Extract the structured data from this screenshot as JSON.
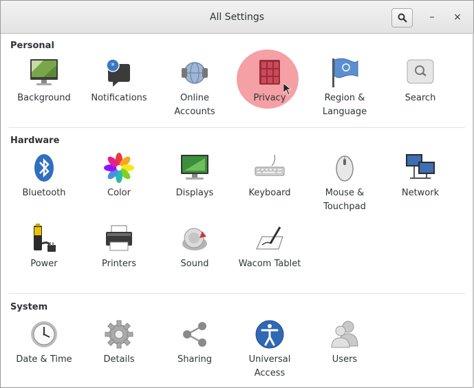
{
  "window": {
    "title": "All Settings",
    "minimize_glyph": "–",
    "close_glyph": "×"
  },
  "sections": {
    "personal": {
      "title": "Personal",
      "items": [
        {
          "label": "Background",
          "icon": "background-icon"
        },
        {
          "label": "Notifications",
          "icon": "notifications-icon"
        },
        {
          "label": "Online\nAccounts",
          "icon": "online-accounts-icon"
        },
        {
          "label": "Privacy",
          "icon": "privacy-icon"
        },
        {
          "label": "Region &\nLanguage",
          "icon": "region-flag-icon"
        },
        {
          "label": "Search",
          "icon": "search-icon"
        }
      ]
    },
    "hardware": {
      "title": "Hardware",
      "items": [
        {
          "label": "Bluetooth",
          "icon": "bluetooth-icon"
        },
        {
          "label": "Color",
          "icon": "color-icon"
        },
        {
          "label": "Displays",
          "icon": "displays-icon"
        },
        {
          "label": "Keyboard",
          "icon": "keyboard-icon"
        },
        {
          "label": "Mouse &\nTouchpad",
          "icon": "mouse-icon"
        },
        {
          "label": "Network",
          "icon": "network-icon"
        },
        {
          "label": "Power",
          "icon": "power-icon"
        },
        {
          "label": "Printers",
          "icon": "printer-icon"
        },
        {
          "label": "Sound",
          "icon": "sound-icon"
        },
        {
          "label": "Wacom Tablet",
          "icon": "wacom-tablet-icon"
        }
      ]
    },
    "system": {
      "title": "System",
      "items": [
        {
          "label": "Date & Time",
          "icon": "clock-icon"
        },
        {
          "label": "Details",
          "icon": "details-gear-icon"
        },
        {
          "label": "Sharing",
          "icon": "sharing-icon"
        },
        {
          "label": "Universal\nAccess",
          "icon": "universal-access-icon"
        },
        {
          "label": "Users",
          "icon": "users-icon"
        }
      ]
    }
  },
  "colors": {
    "highlight": "#f28f95",
    "text": "#2e3436"
  }
}
